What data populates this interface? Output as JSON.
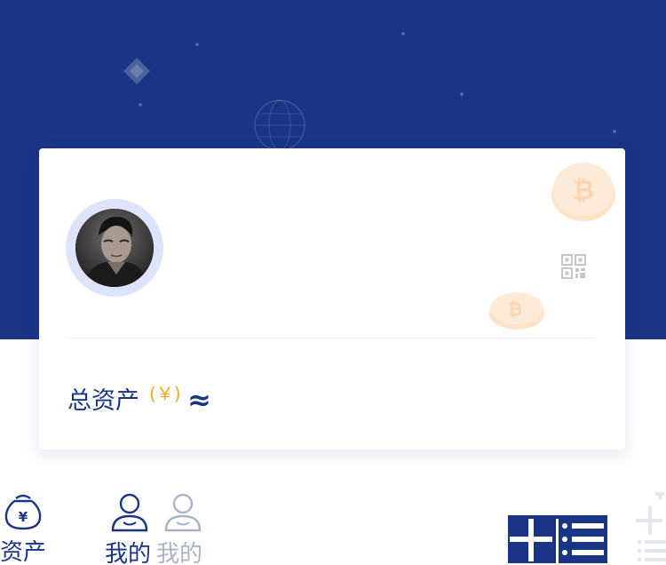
{
  "colors": {
    "brand": "#1a3486",
    "accent": "#f5a623",
    "ring": "#dde4fb"
  },
  "card": {
    "avatar_icon": "user-avatar-photo",
    "qr_icon": "qr-code-icon"
  },
  "assets": {
    "label": "总资产",
    "unit": "(￥)",
    "approx": "≈"
  },
  "nav": {
    "items": [
      {
        "label": "资产",
        "icon": "yen-bag-icon",
        "active": true
      },
      {
        "label": "我的",
        "icon": "user-icon",
        "active": true
      },
      {
        "label": "我的",
        "icon": "user-icon",
        "active": false
      }
    ]
  }
}
